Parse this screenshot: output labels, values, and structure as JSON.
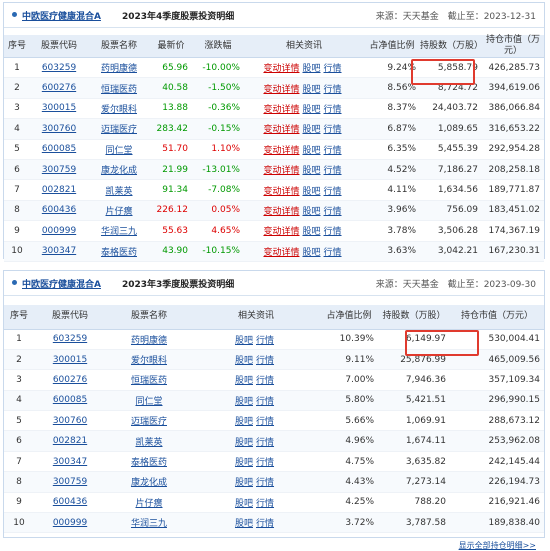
{
  "q4": {
    "fund": "中欧医疗健康混合A",
    "title": "2023年4季度股票投资明细",
    "source": "来源：天天基金　截止至：2023-12-31",
    "headers": [
      "序号",
      "股票代码",
      "股票名称",
      "最新价",
      "涨跌幅",
      "相关资讯",
      "占净值比例",
      "持股数（万股）",
      "持仓市值（万元）"
    ],
    "rows": [
      [
        "1",
        "603259",
        "药明康德",
        "65.96",
        "-10.00%",
        "9.24%",
        "5,858.79",
        "426,285.73"
      ],
      [
        "2",
        "600276",
        "恒瑞医药",
        "40.58",
        "-1.50%",
        "8.56%",
        "8,724.72",
        "394,619.06"
      ],
      [
        "3",
        "300015",
        "爱尔眼科",
        "13.88",
        "-0.36%",
        "8.37%",
        "24,403.72",
        "386,066.84"
      ],
      [
        "4",
        "300760",
        "迈瑞医疗",
        "283.42",
        "-0.15%",
        "6.87%",
        "1,089.65",
        "316,653.22"
      ],
      [
        "5",
        "600085",
        "同仁堂",
        "51.70",
        "1.10%",
        "6.35%",
        "5,455.39",
        "292,954.28"
      ],
      [
        "6",
        "300759",
        "康龙化成",
        "21.99",
        "-13.01%",
        "4.52%",
        "7,186.27",
        "208,258.18"
      ],
      [
        "7",
        "002821",
        "凯莱英",
        "91.34",
        "-7.08%",
        "4.11%",
        "1,634.56",
        "189,771.87"
      ],
      [
        "8",
        "600436",
        "片仔癀",
        "226.12",
        "0.05%",
        "3.96%",
        "756.09",
        "183,451.02"
      ],
      [
        "9",
        "000999",
        "华润三九",
        "55.63",
        "4.65%",
        "3.78%",
        "3,506.28",
        "174,367.19"
      ],
      [
        "10",
        "300347",
        "泰格医药",
        "43.90",
        "-10.15%",
        "3.63%",
        "3,042.21",
        "167,230.31"
      ]
    ],
    "links": [
      "变动详情",
      "股吧",
      "行情"
    ]
  },
  "q3": {
    "fund": "中欧医疗健康混合A",
    "title": "2023年3季度股票投资明细",
    "source": "来源：天天基金　截止至：2023-09-30",
    "headers": [
      "序号",
      "股票代码",
      "股票名称",
      "相关资讯",
      "占净值比例",
      "持股数（万股）",
      "持仓市值（万元）"
    ],
    "rows": [
      [
        "1",
        "603259",
        "药明康德",
        "10.39%",
        "6,149.97",
        "530,004.41"
      ],
      [
        "2",
        "300015",
        "爱尔眼科",
        "9.11%",
        "25,876.99",
        "465,009.56"
      ],
      [
        "3",
        "600276",
        "恒瑞医药",
        "7.00%",
        "7,946.36",
        "357,109.34"
      ],
      [
        "4",
        "600085",
        "同仁堂",
        "5.80%",
        "5,421.51",
        "296,990.15"
      ],
      [
        "5",
        "300760",
        "迈瑞医疗",
        "5.66%",
        "1,069.91",
        "288,673.12"
      ],
      [
        "6",
        "002821",
        "凯莱英",
        "4.96%",
        "1,674.11",
        "253,962.08"
      ],
      [
        "7",
        "300347",
        "泰格医药",
        "4.75%",
        "3,635.82",
        "242,145.44"
      ],
      [
        "8",
        "300759",
        "康龙化成",
        "4.43%",
        "7,273.14",
        "226,194.73"
      ],
      [
        "9",
        "600436",
        "片仔癀",
        "4.25%",
        "788.20",
        "216,921.46"
      ],
      [
        "10",
        "000999",
        "华润三九",
        "3.72%",
        "3,787.58",
        "189,838.40"
      ]
    ],
    "links": [
      "股吧",
      "行情"
    ],
    "more": "显示全部持仓明细>>"
  },
  "colors": {
    "up": "#dd0000",
    "down": "#009900",
    "link": "#1a4f9c",
    "highlight": "#e03a2e"
  }
}
